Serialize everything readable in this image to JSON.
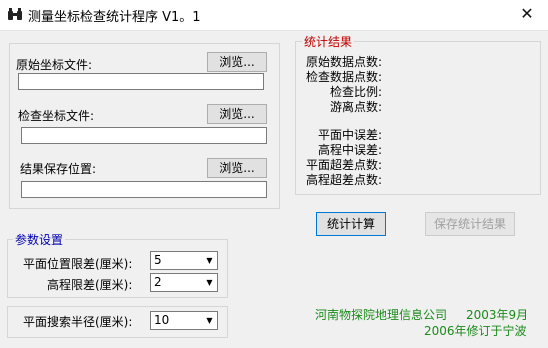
{
  "window": {
    "title": "测量坐标检查统计程序 V1。1",
    "close_glyph": "✕",
    "icon": "binoculars-icon"
  },
  "files": {
    "original_label": "原始坐标文件:",
    "original_value": "",
    "check_label": "检查坐标文件:",
    "check_value": "",
    "result_label": "结果保存位置:",
    "result_value": "",
    "browse_label": "浏览..."
  },
  "stats": {
    "title": "统计结果",
    "orig_count": "原始数据点数:",
    "check_count": "检查数据点数:",
    "check_ratio": "检查比例:",
    "outlier_count": "游离点数:",
    "plane_rmse": "平面中误差:",
    "height_rmse": "高程中误差:",
    "plane_exceed": "平面超差点数:",
    "height_exceed": "高程超差点数:"
  },
  "actions": {
    "compute": "统计计算",
    "save": "保存统计结果"
  },
  "params": {
    "title": "参数设置",
    "plane_label": "平面位置限差(厘米):",
    "plane_value": "5",
    "height_label": "高程限差(厘米):",
    "height_value": "2",
    "radius_label": "平面搜索半径(厘米):",
    "radius_value": "10"
  },
  "credits": {
    "org": "河南物探院地理信息公司",
    "date1": "2003年9月",
    "revision": "2006年修订于宁波",
    "color": "#1a8a1a"
  }
}
